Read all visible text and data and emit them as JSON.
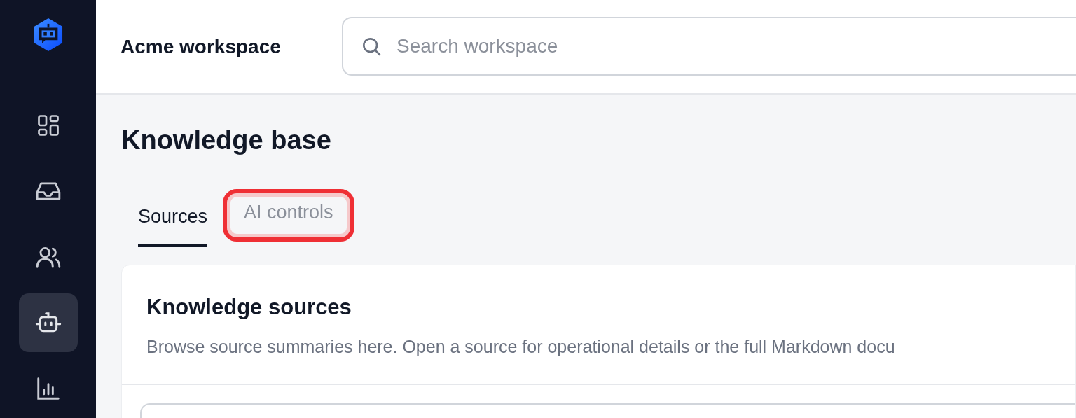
{
  "sidebar": {
    "items": [
      {
        "selected": false
      },
      {
        "selected": false
      },
      {
        "selected": false
      },
      {
        "selected": true
      },
      {
        "selected": false
      }
    ]
  },
  "header": {
    "workspace": "Acme workspace",
    "search": {
      "placeholder": "Search workspace"
    }
  },
  "page": {
    "title": "Knowledge base",
    "tabs": [
      {
        "label": "Sources",
        "selected": true,
        "highlighted": false
      },
      {
        "label": "AI controls",
        "selected": false,
        "highlighted": true
      }
    ]
  },
  "card": {
    "title": "Knowledge sources",
    "description": "Browse source summaries here. Open a source for operational details or the full Markdown docu"
  }
}
